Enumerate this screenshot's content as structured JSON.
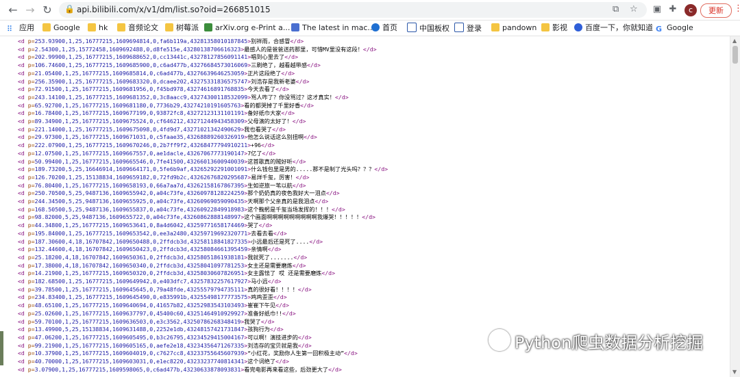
{
  "browser": {
    "url": "api.bilibili.com/x/v1/dm/list.so?oid=266851015",
    "update_label": "更新",
    "avatar_letter": "c",
    "icons": [
      "back-icon",
      "forward-icon",
      "reload-icon",
      "lock-icon",
      "translate-icon",
      "star-icon",
      "extension-icon",
      "puzzle-icon",
      "menu-icon"
    ]
  },
  "bookmarks": [
    {
      "label": "应用",
      "icon": "apps-grid-icon"
    },
    {
      "label": "Google",
      "icon": "folder-icon"
    },
    {
      "label": "hk",
      "icon": "folder-icon"
    },
    {
      "label": "音频论文",
      "icon": "folder-icon"
    },
    {
      "label": "树莓派",
      "icon": "folder-icon"
    },
    {
      "label": "arXiv.org e-Print a...",
      "icon": "arxiv-icon"
    },
    {
      "label": "The latest in mac...",
      "icon": "bookmark-icon"
    },
    {
      "label": "首页",
      "icon": "site-icon"
    },
    {
      "label": "中国板权",
      "icon": "site-icon"
    },
    {
      "label": "登录",
      "icon": "site-icon"
    },
    {
      "label": "pandown",
      "icon": "folder-icon"
    },
    {
      "label": "影视",
      "icon": "folder-icon"
    },
    {
      "label": "百度一下，你就知道",
      "icon": "paw-icon"
    },
    {
      "label": "Google",
      "icon": "google-icon"
    }
  ],
  "xml_lines": [
    {
      "p": "253.93900,1,25,16777215,1609694814,0,fa6b119a,43281358010187845",
      "text": "别袢雨，合感冒"
    },
    {
      "p": "2.54300,1,25,15772458,1609692488,0,d8fe515e,43280138706616323",
      "text": "最感人的是爸爸送药那里，可惜MV里没有这段！"
    },
    {
      "p": "202.99900,1,25,16777215,1609688652,0,cc13441c,43278127856091141",
      "text": "唱到心里去了"
    },
    {
      "p": "106.74600,1,25,16777215,1609685900,0,c6ad477b,43276684573016069",
      "text": "三刷绝了，越看越带感"
    },
    {
      "p": "21.05400,1,25,16777215,1609685814,0,c6ad477b,43276639646253059",
      "text": "正片这段绝了"
    },
    {
      "p": "256.35900,1,25,16777215,1609683320,0,dcaee202,43275331836575747",
      "text": "刘浩存是我新老婆"
    },
    {
      "p": "72.91500,1,25,16777215,1609681956,0,f45bd978,43274616891768835",
      "text": "今天去看了"
    },
    {
      "p": "243.14100,1,25,16777215,1609681352,0,3c8aacc9,43274300118532099",
      "text": "骂人咋了？你没骂过？这才真实！"
    },
    {
      "p": "65.92700,1,25,16777215,1609681180,0,7736b29,43274210191605763",
      "text": "看的都哭掉了千里好香"
    },
    {
      "p": "16.78400,1,25,16777215,1609677199,0,93872fc8,43272123131101191",
      "text": "备好纸巾大家"
    },
    {
      "p": "89.34900,1,25,16777215,1609675524,0,cf646212,43271244943458309",
      "text": "父母演的太好了！"
    },
    {
      "p": "221.14000,1,25,16777215,1609675098,0,4fd9d7,43271021342490629",
      "text": "我也看哭了"
    },
    {
      "p": "29.97300,1,25,16777215,1609671031,0,c5faae35,43268889260326919",
      "text": "他怎么说话这么别扭啊"
    },
    {
      "p": "222.07900,1,25,16777215,1609670246,0,2b7ff9f2,43268477794910211",
      "text": "+96"
    },
    {
      "p": "12.07500,1,25,16777215,1609667557,0,ae1dacle,43267067773190147",
      "text": "7亿了"
    },
    {
      "p": "50.99400,1,25,16777215,1609665546,0,7fe41500,43266013600940039",
      "text": "这首歌真的贼好听"
    },
    {
      "p": "189.73200,5,25,16646914,1609664171,0,5fe6b9af,43265292291001091",
      "text": "什么钱包里是男的.....那不是制了光头吗？？？"
    },
    {
      "p": "126.70200,1,25,15138834,1609659182,0,72fd9b2c,43262676820295687",
      "text": "易烊千玺，厉害！"
    },
    {
      "p": "76.80400,1,25,16777215,1609658193,0,66a7aa7d,43262158167867395",
      "text": "生如逆旅一苇以航"
    },
    {
      "p": "250.70500,5,25,9487136,1609655942,0,a04c73fe,43260978128224259",
      "text": "那个奶奶真的夜色我好大一泪点"
    },
    {
      "p": "244.34500,5,25,9487136,1609655925,0,a04c73fe,43260969059090435",
      "text": "天啊那个父亲真的是我泪点"
    },
    {
      "p": "168.50500,5,25,9487136,1609655837,0,a04c73fe,43260922849918983",
      "text": "这个鞠躬是千玺当场发挥的！！！"
    },
    {
      "p": "98.82000,5,25,9487136,1609655722,0,a04c73fe,43260862888148997",
      "text": "这个画面啊啊啊啊啊啊啊啊啊我爆哭！！！！！"
    },
    {
      "p": "44.34800,1,25,16777215,1609653641,0,8a4d6042,43259771658174469",
      "text": "哭了"
    },
    {
      "p": "195.84000,1,25,16777215,1609653542,0,ee3a2480,43259719692320771",
      "text": "去看去看"
    },
    {
      "p": "187.30600,4,18,16707842,1609650488,0,2ffdcb3d,43258118841827335",
      "text": "小远最后还是死了...."
    },
    {
      "p": "132.44600,4,18,16707842,1609650423,0,2ffdcb3d,43258084661395459",
      "text": "亲情啊"
    },
    {
      "p": "25.18200,4,18,16707842,1609650361,0,2ffdcb3d,43258051861938181",
      "text": "我就死了......."
    },
    {
      "p": "17.38000,4,18,16707842,1609650340,0,2ffdcb3d,43258041097781253",
      "text": "女主还是需要磨炼"
    },
    {
      "p": "14.21900,1,25,16777215,1609650320,0,2ffdcb3d,43258030607826951",
      "text": "女主露怯了 哎 还是需要磨炼"
    },
    {
      "p": "182.68500,1,25,16777215,1609649942,0,e403dfc7,43257832257617927",
      "text": "马小远"
    },
    {
      "p": "39.78500,1,25,16777215,1609645645,0,79a48fde,43255579794735111",
      "text": "真的很好看！！！！"
    },
    {
      "p": "234.83400,1,25,16777215,1609645490,0,e835991b,43255498177773575",
      "text": "鸡鸡歪歪"
    },
    {
      "p": "48.65100,1,25,16777215,1609640694,0,41657b82,43252983543103493",
      "text": "崔崔下午见"
    },
    {
      "p": "25.02600,1,25,16777215,1609637797,0,45400c60,43251464910929927",
      "text": "准备好纸巾!!"
    },
    {
      "p": "59.70100,1,25,16777215,1609636503,0,e3c3562,43250786268348419",
      "text": "我哭了"
    },
    {
      "p": "13.49900,5,25,15138834,1609631488,0,2252e1db,43248157421731847",
      "text": "孩狗行为"
    },
    {
      "p": "47.06200,1,25,16777215,1609605495,0,b3c26795,43234529415004167",
      "text": "可以啊！演技进步的"
    },
    {
      "p": "99.21900,1,25,16777215,1609605165,0,aefe2e18,43234356471267335",
      "text": "刘浩存的宝贝就是我"
    },
    {
      "p": "10.37900,1,25,16777215,1609604019,0,c7627cc8,43233755645607939",
      "text": "“小红花，奖励你人生第一回积极主动”"
    },
    {
      "p": "40.70000,1,25,16777215,1609603031,0,e1ec8220,43233237740814341",
      "text": "这个词绝了"
    },
    {
      "p": "3.07900,1,25,16777215,1609598065,0,c6ad477b,43230633878093831",
      "text": "看完电影再来看这些，后劲更大了"
    }
  ],
  "watermark": {
    "text": "Python爬虫数据分析挖掘",
    "icon": "wechat-channel-icon"
  }
}
